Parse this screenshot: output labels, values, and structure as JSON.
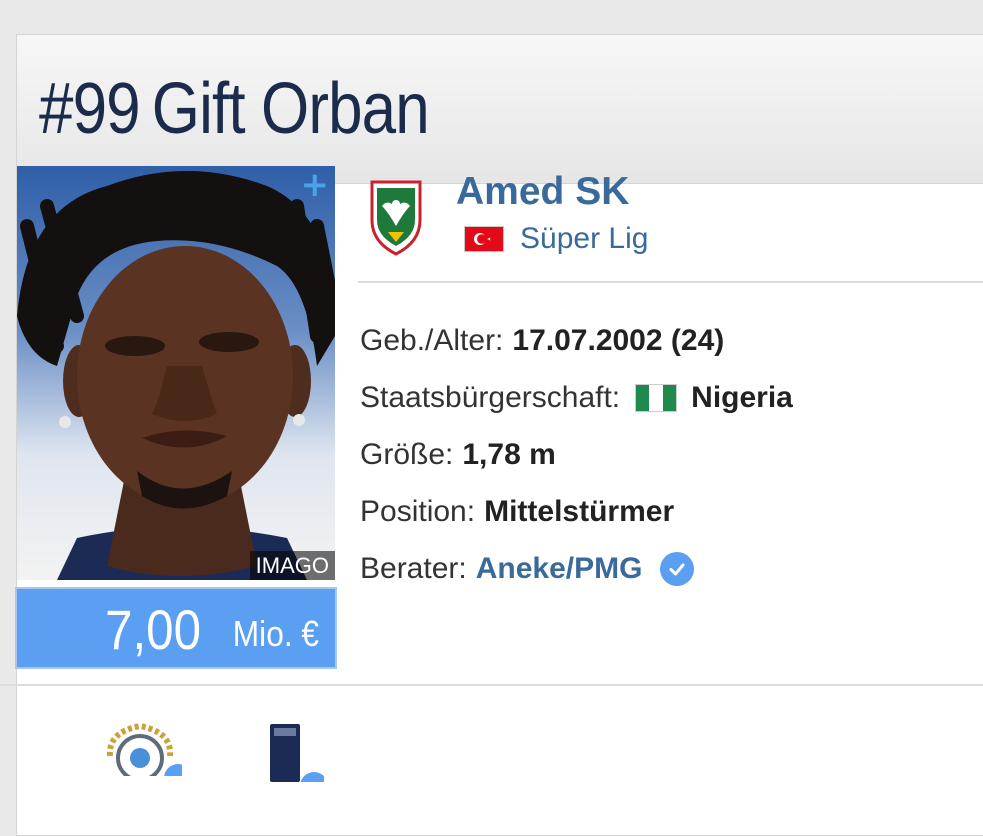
{
  "player": {
    "number": "#99",
    "name": "Gift Orban",
    "photo_credit": "IMAGO",
    "market_value": {
      "amount": "7,00",
      "unit": "Mio. €"
    }
  },
  "club": {
    "name": "Amed SK",
    "league": "Süper Lig"
  },
  "info": {
    "birth_label": "Geb./Alter:",
    "birth_value": "17.07.2002 (24)",
    "citizenship_label": "Staatsbürgerschaft:",
    "citizenship_value": "Nigeria",
    "height_label": "Größe:",
    "height_value": "1,78 m",
    "position_label": "Position:",
    "position_value": "Mittelstürmer",
    "agent_label": "Berater:",
    "agent_value": "Aneke/PMG"
  },
  "colors": {
    "title": "#1a2b4c",
    "link": "#3a6a9b",
    "value_box": "#5b9ff2",
    "verified": "#5b9ff2"
  },
  "icons": [
    "plus-icon",
    "club-crest-icon",
    "turkey-flag-icon",
    "nigeria-flag-icon",
    "verified-icon",
    "award-icon"
  ]
}
